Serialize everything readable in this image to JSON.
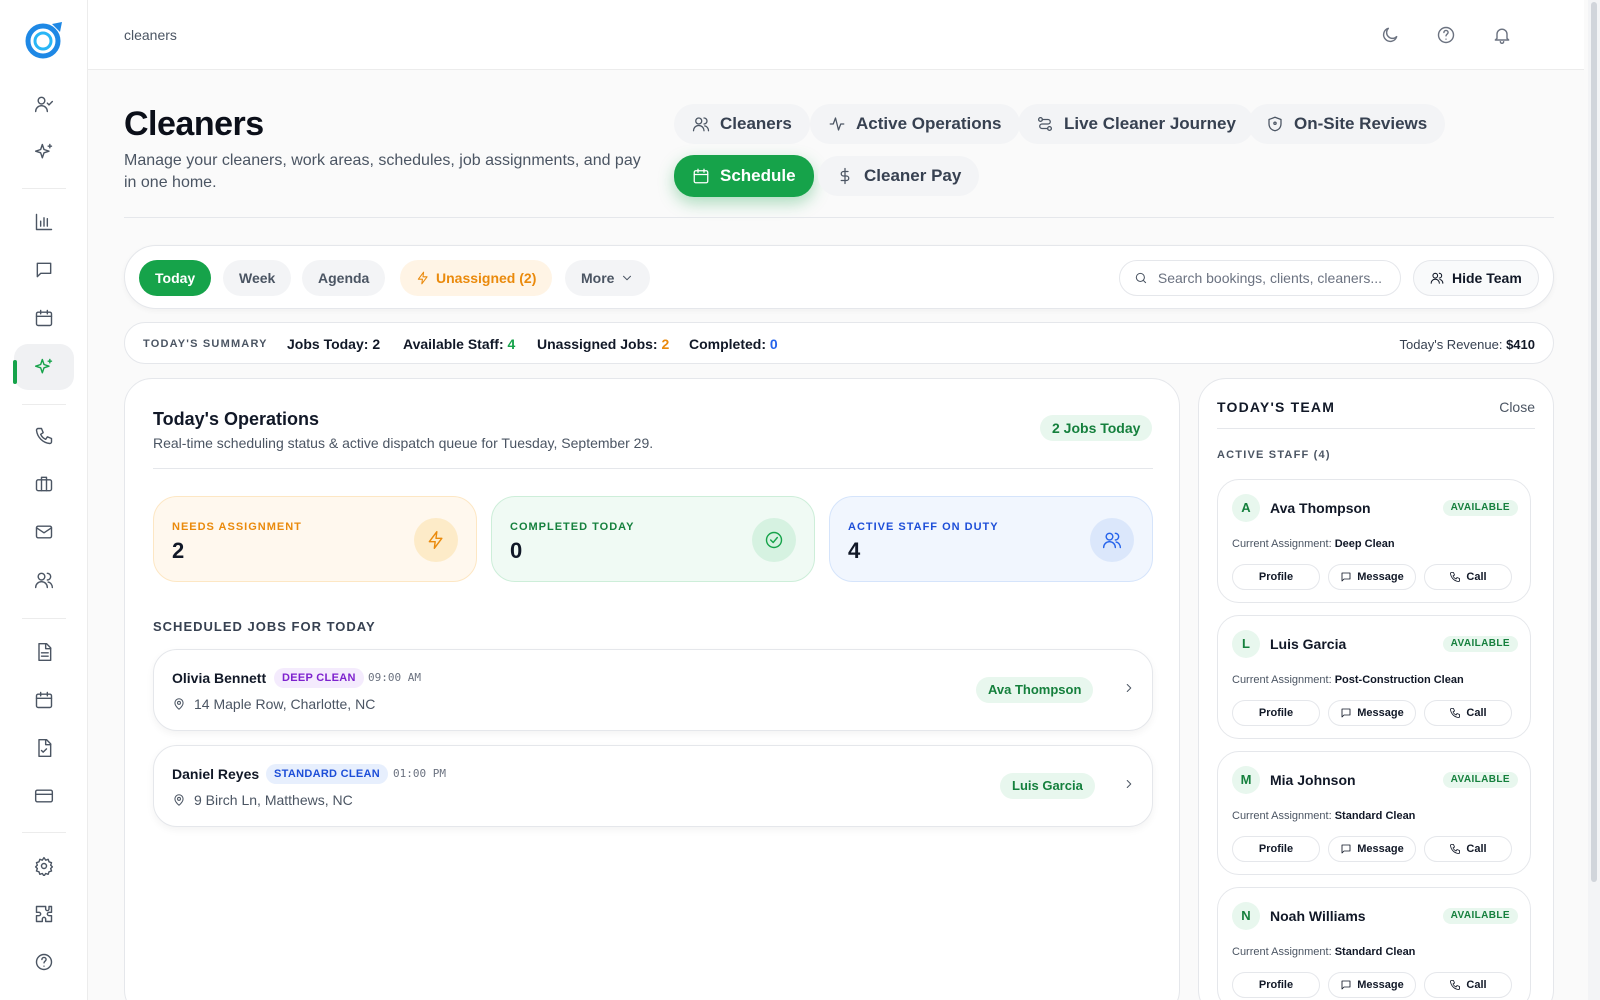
{
  "app": {
    "breadcrumb": "cleaners"
  },
  "sidebar": {
    "items": [
      {
        "icon": "user-check-icon"
      },
      {
        "icon": "sparkles-icon"
      },
      {
        "icon": "bar-chart-icon"
      },
      {
        "icon": "message-square-icon"
      },
      {
        "icon": "calendar-icon"
      },
      {
        "icon": "sparkles-icon",
        "active": true
      },
      {
        "icon": "phone-icon"
      },
      {
        "icon": "briefcase-icon"
      },
      {
        "icon": "mail-icon"
      },
      {
        "icon": "users-icon"
      },
      {
        "icon": "file-text-icon"
      },
      {
        "icon": "calendar-icon"
      },
      {
        "icon": "file-check-icon"
      },
      {
        "icon": "credit-card-icon"
      },
      {
        "icon": "gear-icon"
      },
      {
        "icon": "puzzle-icon"
      },
      {
        "icon": "help-circle-icon"
      }
    ]
  },
  "topbar": {
    "icons": [
      "moon-icon",
      "help-circle-icon",
      "bell-icon"
    ]
  },
  "header": {
    "title": "Cleaners",
    "subtitle": "Manage your cleaners, work areas, schedules, job assignments, and pay in one home.",
    "tabs": [
      {
        "label": "Cleaners",
        "icon": "users-icon"
      },
      {
        "label": "Active Operations",
        "icon": "activity-icon"
      },
      {
        "label": "Live Cleaner Journey",
        "icon": "route-icon"
      },
      {
        "label": "On-Site Reviews",
        "icon": "shield-icon"
      },
      {
        "label": "Schedule",
        "icon": "calendar-icon",
        "active": true
      },
      {
        "label": "Cleaner Pay",
        "icon": "dollar-icon"
      }
    ]
  },
  "filters": {
    "today": "Today",
    "week": "Week",
    "agenda": "Agenda",
    "unassigned": "Unassigned (2)",
    "more": "More",
    "search_placeholder": "Search bookings, clients, cleaners...",
    "hide_team": "Hide Team"
  },
  "summary": {
    "label": "TODAY'S SUMMARY",
    "jobs_label": "Jobs Today:",
    "jobs_value": "2",
    "staff_label": "Available Staff:",
    "staff_value": "4",
    "unassigned_label": "Unassigned Jobs:",
    "unassigned_value": "2",
    "completed_label": "Completed:",
    "completed_value": "0",
    "revenue_label": "Today's Revenue:",
    "revenue_value": "$410"
  },
  "operations": {
    "title": "Today's Operations",
    "subtitle": "Real-time scheduling status & active dispatch queue for Tuesday, September 29.",
    "badge": "2 Jobs Today",
    "stats": [
      {
        "label": "NEEDS ASSIGNMENT",
        "value": "2",
        "icon": "zap-icon"
      },
      {
        "label": "COMPLETED TODAY",
        "value": "0",
        "icon": "check-circle-icon"
      },
      {
        "label": "ACTIVE STAFF ON DUTY",
        "value": "4",
        "icon": "users-icon"
      }
    ],
    "scheduled_heading": "SCHEDULED JOBS FOR TODAY",
    "jobs": [
      {
        "client": "Olivia Bennett",
        "service": "DEEP CLEAN",
        "time": "09:00 AM",
        "address": "14 Maple Row, Charlotte, NC",
        "assignee": "Ava Thompson"
      },
      {
        "client": "Daniel Reyes",
        "service": "STANDARD CLEAN",
        "time": "01:00 PM",
        "address": "9 Birch Ln, Matthews, NC",
        "assignee": "Luis Garcia"
      }
    ]
  },
  "team": {
    "title": "TODAY'S TEAM",
    "close": "Close",
    "subtitle": "ACTIVE STAFF (4)",
    "assignment_label": "Current Assignment:",
    "status": "AVAILABLE",
    "buttons": {
      "profile": "Profile",
      "message": "Message",
      "call": "Call"
    },
    "staff": [
      {
        "initial": "A",
        "name": "Ava Thompson",
        "assignment": "Deep Clean"
      },
      {
        "initial": "L",
        "name": "Luis Garcia",
        "assignment": "Post-Construction Clean"
      },
      {
        "initial": "M",
        "name": "Mia Johnson",
        "assignment": "Standard Clean"
      },
      {
        "initial": "N",
        "name": "Noah Williams",
        "assignment": "Standard Clean"
      }
    ]
  },
  "colors": {
    "accent": "#16a34a",
    "warning": "#ea8a0c",
    "info": "#2563eb",
    "deep_clean": "#7e22ce"
  }
}
